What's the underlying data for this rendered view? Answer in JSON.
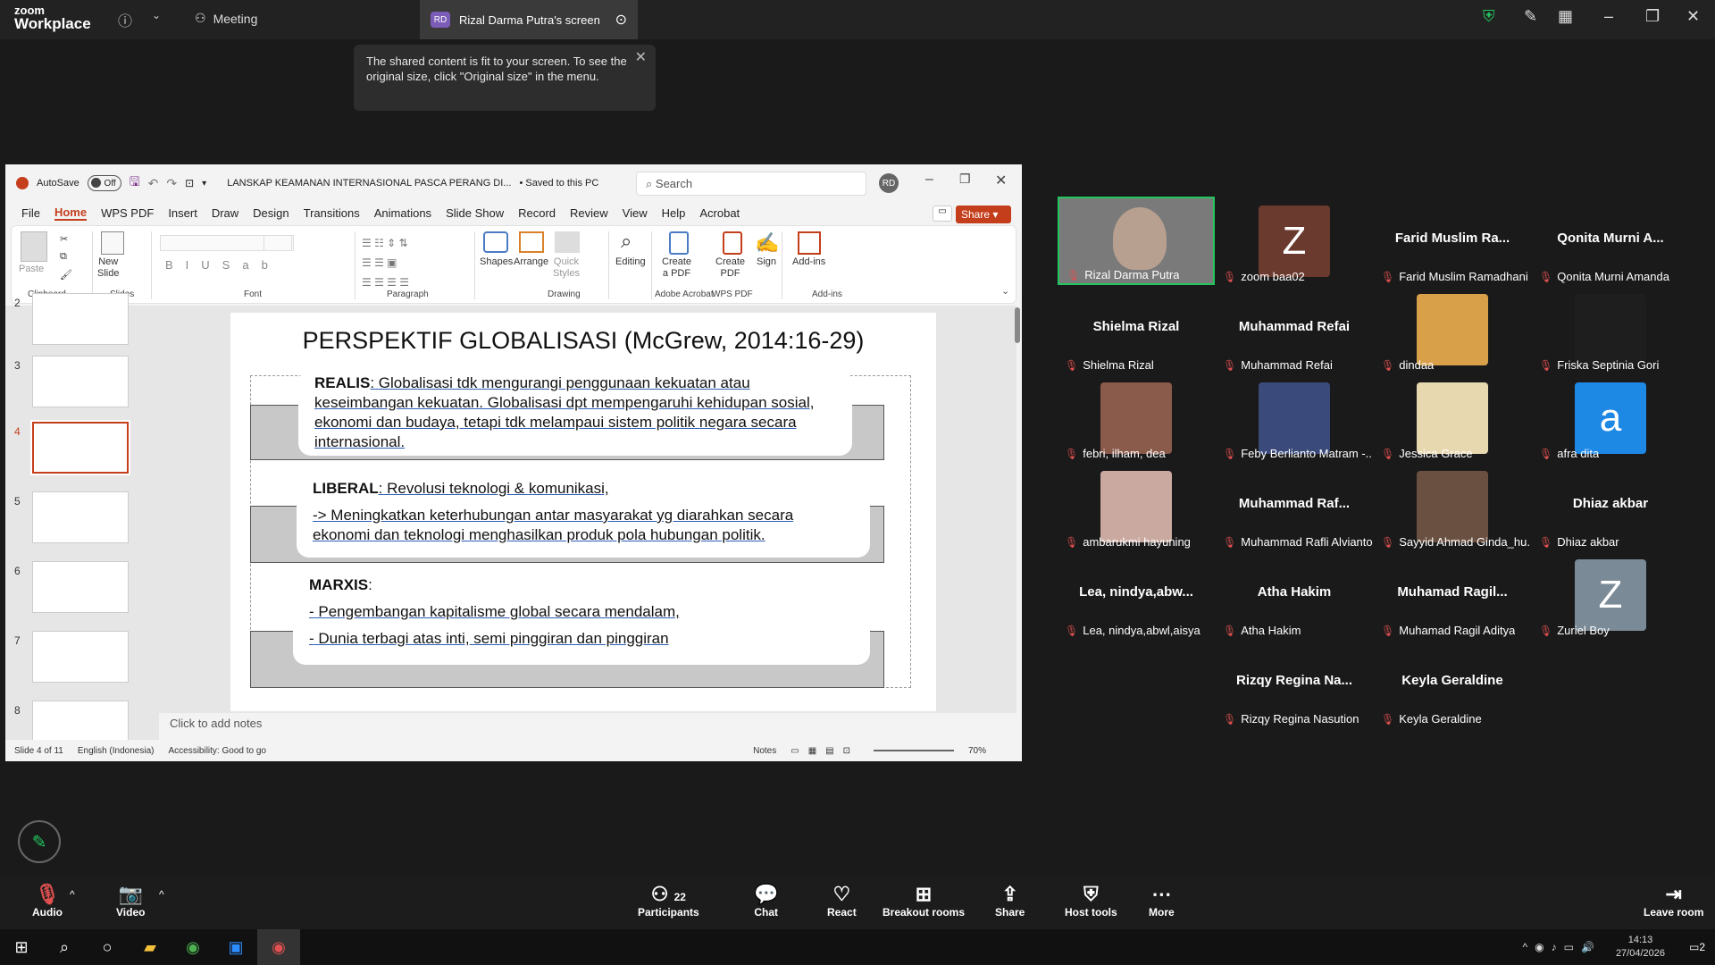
{
  "zoom": {
    "logo_small": "zoom",
    "logo_big": "Workplace",
    "meeting_label": "Meeting",
    "share_tab": "Rizal Darma Putra's screen",
    "share_initials": "RD"
  },
  "toast": {
    "text": "The shared content is fit to your screen. To see the original size, click \"Original size\" in the menu."
  },
  "ppt": {
    "autosave": "AutoSave",
    "toggle": "Off",
    "doc_title": "LANSKAP KEAMANAN INTERNASIONAL PASCA PERANG DI...",
    "saved": "• Saved to this PC",
    "search_placeholder": "Search",
    "user_initials": "RD",
    "share_btn": "Share",
    "menu": [
      "File",
      "Home",
      "WPS PDF",
      "Insert",
      "Draw",
      "Design",
      "Transitions",
      "Animations",
      "Slide Show",
      "Record",
      "Review",
      "View",
      "Help",
      "Acrobat"
    ],
    "ribbon": {
      "paste": "Paste",
      "new_slide": "New\nSlide",
      "shapes": "Shapes",
      "arrange": "Arrange",
      "quick_styles": "Quick\nStyles",
      "editing": "Editing",
      "create_pdf1": "Create\na PDF",
      "create_pdf2": "Create\nPDF",
      "sign": "Sign",
      "addins": "Add-ins",
      "groups": [
        "Clipboard",
        "Slides",
        "Font",
        "Paragraph",
        "Drawing",
        "Adobe Acrobat",
        "WPS PDF",
        "Add-ins"
      ]
    },
    "thumb_numbers": [
      "2",
      "3",
      "4",
      "5",
      "6",
      "7",
      "8"
    ],
    "slide": {
      "title": "PERSPEKTIF GLOBALISASI (McGrew, 2014:16-29)",
      "realis_label": "REALIS",
      "realis_text": ": Globalisasi tdk mengurangi penggunaan kekuatan atau keseimbangan kekuatan. Globalisasi dpt mempengaruhi kehidupan sosial, ekonomi dan budaya, tetapi tdk melampaui sistem politik negara secara internasional.",
      "liberal_label": "LIBERAL",
      "liberal_text": ": Revolusi teknologi & komunikasi,",
      "liberal_text2": "-> Meningkatkan keterhubungan antar masyarakat yg diarahkan secara ekonomi dan teknologi menghasilkan produk pola hubungan politik.",
      "marxis_label": "MARXIS",
      "marxis_colon": ":",
      "marxis_1": "- Pengembangan kapitalisme global secara mendalam,",
      "marxis_2": "- Dunia terbagi atas inti, semi pinggiran dan pinggiran"
    },
    "notes": "Click to add notes",
    "status": {
      "slide": "Slide 4 of 11",
      "lang": "English (Indonesia)",
      "access": "Accessibility: Good to go",
      "notes": "Notes",
      "zoom": "70%"
    }
  },
  "participants": [
    {
      "name": "Rizal Darma Putra",
      "big": "",
      "kind": "video"
    },
    {
      "name": "zoom baa02",
      "big": "Z",
      "kind": "avatar",
      "color": "#6b3a2e"
    },
    {
      "name": "Farid Muslim Ramadhani",
      "big": "Farid Muslim Ra...",
      "kind": "text"
    },
    {
      "name": "Qonita Murni Amanda",
      "big": "Qonita Murni A...",
      "kind": "text"
    },
    {
      "name": "Shielma Rizal",
      "big": "Shielma Rizal",
      "kind": "text"
    },
    {
      "name": "Muhammad Refai",
      "big": "Muhammad Refai",
      "kind": "text"
    },
    {
      "name": "dindaa",
      "big": "",
      "kind": "avatar",
      "color": "#d9a04a"
    },
    {
      "name": "Friska Septinia Gori",
      "big": "",
      "kind": "avatar",
      "color": "#1e1e1e"
    },
    {
      "name": "febri, ilham, dea",
      "big": "",
      "kind": "avatar",
      "color": "#8a5a4a"
    },
    {
      "name": "Feby Berlianto Matram -...",
      "big": "",
      "kind": "avatar",
      "color": "#3a4a7a"
    },
    {
      "name": "Jessica Grace",
      "big": "",
      "kind": "avatar",
      "color": "#e8d8b0"
    },
    {
      "name": "afra dita",
      "big": "a",
      "kind": "avatar",
      "color": "#1e88e5"
    },
    {
      "name": "ambarukmi hayuning",
      "big": "",
      "kind": "avatar",
      "color": "#c9a9a0"
    },
    {
      "name": "Muhammad Rafli Alvianto",
      "big": "Muhammad Raf...",
      "kind": "text"
    },
    {
      "name": "Sayyid Ahmad Ginda_hu...",
      "big": "",
      "kind": "avatar",
      "color": "#6a5040"
    },
    {
      "name": "Dhiaz akbar",
      "big": "Dhiaz akbar",
      "kind": "text"
    },
    {
      "name": "Lea, nindya,abwl,aisya",
      "big": "Lea,  nindya,abw...",
      "kind": "text"
    },
    {
      "name": "Atha Hakim",
      "big": "Atha Hakim",
      "kind": "text"
    },
    {
      "name": "Muhamad Ragil Aditya",
      "big": "Muhamad  Ragil...",
      "kind": "text"
    },
    {
      "name": "Zuriel Boy",
      "big": "Z",
      "kind": "avatar",
      "color": "#7a8a96"
    },
    {
      "name": "",
      "big": "",
      "kind": "empty"
    },
    {
      "name": "Rizqy Regina Nasution",
      "big": "Rizqy  Regina  Na...",
      "kind": "text"
    },
    {
      "name": "Keyla Geraldine",
      "big": "Keyla Geraldine",
      "kind": "text"
    }
  ],
  "toolbar": {
    "audio": "Audio",
    "video": "Video",
    "participants": "Participants",
    "participants_count": "22",
    "chat": "Chat",
    "react": "React",
    "breakout": "Breakout rooms",
    "share": "Share",
    "host": "Host tools",
    "more": "More",
    "leave": "Leave room"
  },
  "taskbar": {
    "time": "14:13",
    "date": "27/04/2026",
    "notif": "2"
  }
}
